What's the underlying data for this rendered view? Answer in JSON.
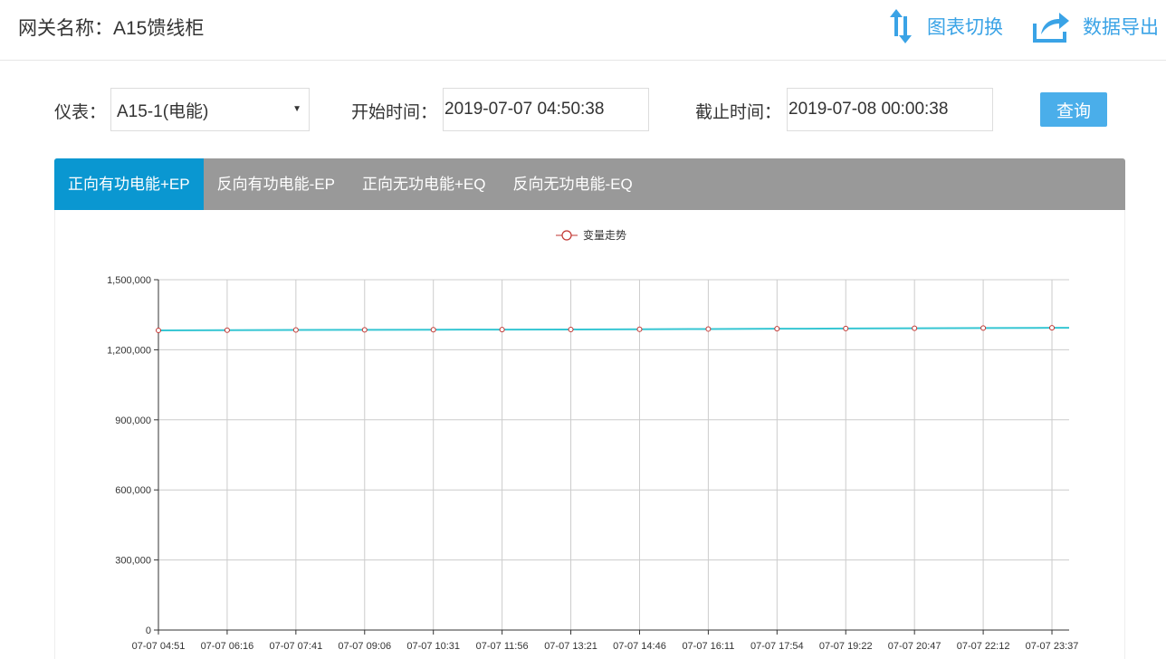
{
  "header": {
    "gateway_label": "网关名称：",
    "gateway_name": "A15馈线柜",
    "switch_label": "图表切换",
    "export_label": "数据导出",
    "switch_icon": "swap-vertical-icon",
    "export_icon": "share-export-icon"
  },
  "filters": {
    "meter_label": "仪表：",
    "meter_value": "A15-1(电能)",
    "start_label": "开始时间：",
    "start_value": "2019-07-07 04:50:38",
    "end_label": "截止时间：",
    "end_value": "2019-07-08 00:00:38",
    "query_label": "查询"
  },
  "tabs": [
    {
      "label": "正向有功电能+EP",
      "active": true
    },
    {
      "label": "反向有功电能-EP",
      "active": false
    },
    {
      "label": "正向无功电能+EQ",
      "active": false
    },
    {
      "label": "反向无功电能-EQ",
      "active": false
    }
  ],
  "colors": {
    "accent": "#0a97d1",
    "button": "#4aaeea",
    "tab_bar": "#999999",
    "line": "#36c6d3",
    "marker": "#c23531"
  },
  "chart_data": {
    "type": "line",
    "legend": "变量走势",
    "legend_position": "top-center",
    "grid": true,
    "ylim": [
      0,
      1500000
    ],
    "yticks": [
      "0",
      "300,000",
      "600,000",
      "900,000",
      "1,200,000",
      "1,500,000"
    ],
    "ytick_values": [
      0,
      300000,
      600000,
      900000,
      1200000,
      1500000
    ],
    "categories": [
      "07-07 04:51",
      "07-07 06:16",
      "07-07 07:41",
      "07-07 09:06",
      "07-07 10:31",
      "07-07 11:56",
      "07-07 13:21",
      "07-07 14:46",
      "07-07 16:11",
      "07-07 17:54",
      "07-07 19:22",
      "07-07 20:47",
      "07-07 22:12",
      "07-07 23:37"
    ],
    "series": [
      {
        "name": "变量走势",
        "values": [
          1283000,
          1284000,
          1285000,
          1285500,
          1286000,
          1286500,
          1287000,
          1288000,
          1289000,
          1290000,
          1291000,
          1292000,
          1293000,
          1294000
        ]
      }
    ]
  }
}
